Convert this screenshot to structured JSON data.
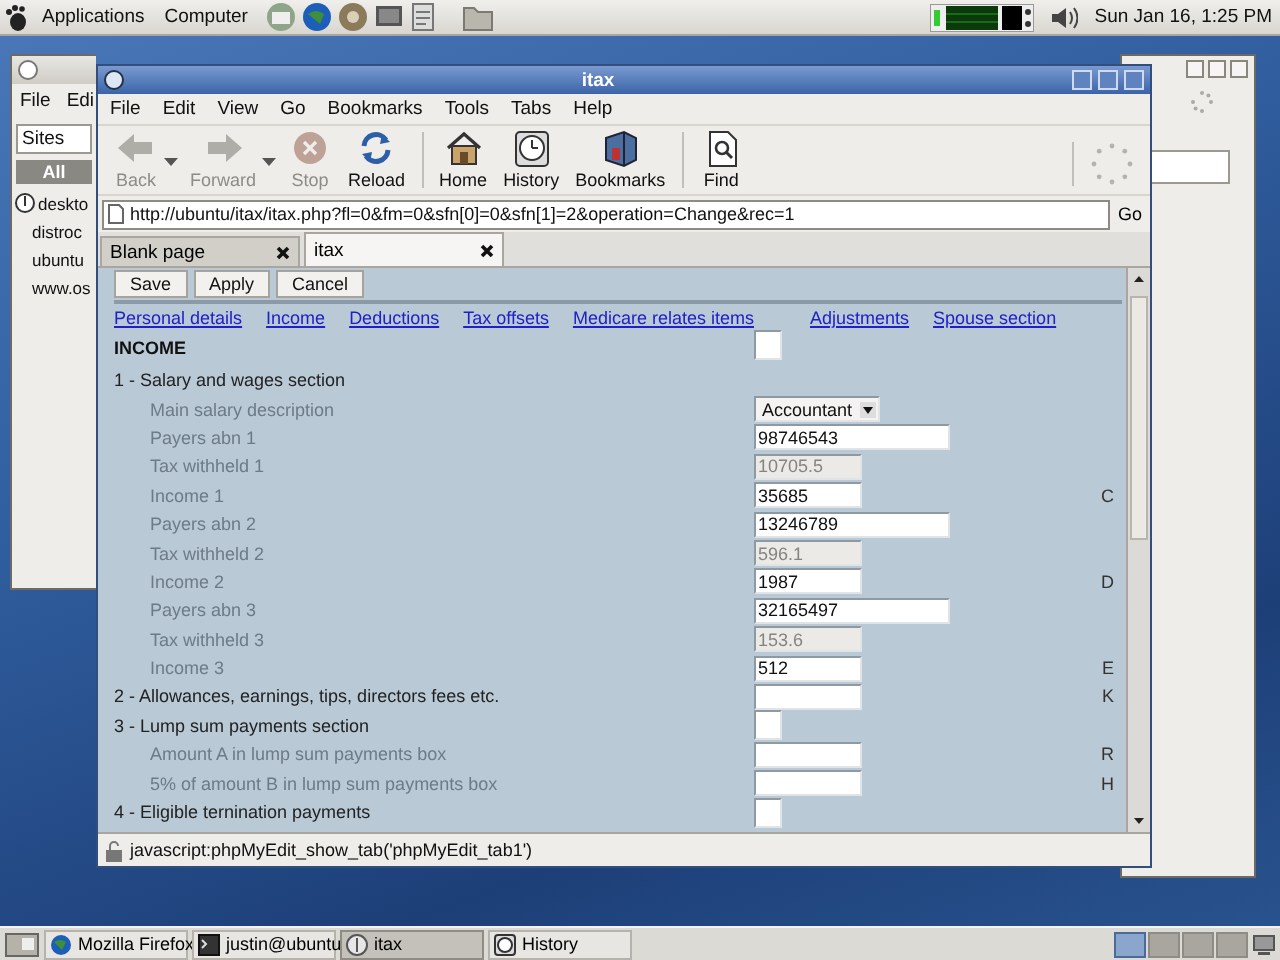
{
  "top_panel": {
    "menus": [
      {
        "label": "Applications"
      },
      {
        "label": "Computer"
      }
    ],
    "clock": "Sun Jan 16,  1:25 PM"
  },
  "back_window": {
    "menu": [
      "File",
      "Edi"
    ],
    "search_label": "Sites",
    "filter": {
      "label": "All",
      "selected": true
    },
    "sites": [
      {
        "label": "deskto",
        "has_icon": true
      },
      {
        "label": "distroc",
        "has_icon": false
      },
      {
        "label": "ubuntu",
        "has_icon": false
      },
      {
        "label": "www.os",
        "has_icon": false
      }
    ]
  },
  "browser": {
    "title": "itax",
    "menu": [
      "File",
      "Edit",
      "View",
      "Go",
      "Bookmarks",
      "Tools",
      "Tabs",
      "Help"
    ],
    "toolbar": [
      {
        "kind": "back",
        "label": "Back",
        "disabled": true,
        "dropdown": true
      },
      {
        "kind": "forward",
        "label": "Forward",
        "disabled": true,
        "dropdown": true
      },
      {
        "kind": "stop",
        "label": "Stop",
        "disabled": true,
        "dropdown": false
      },
      {
        "kind": "reload",
        "label": "Reload",
        "disabled": false,
        "dropdown": false
      },
      {
        "kind": "separator"
      },
      {
        "kind": "home",
        "label": "Home",
        "disabled": false,
        "dropdown": false
      },
      {
        "kind": "history",
        "label": "History",
        "disabled": false,
        "dropdown": false
      },
      {
        "kind": "bookmarks",
        "label": "Bookmarks",
        "disabled": false,
        "dropdown": false
      },
      {
        "kind": "separator"
      },
      {
        "kind": "find",
        "label": "Find",
        "disabled": false,
        "dropdown": false
      }
    ],
    "address": "http://ubuntu/itax/itax.php?fl=0&fm=0&sfn[0]=0&sfn[1]=2&operation=Change&rec=1",
    "go": "Go",
    "tabs": [
      {
        "label": "Blank page",
        "selected": false
      },
      {
        "label": "itax",
        "selected": true
      }
    ],
    "form_buttons": [
      "Save",
      "Apply",
      "Cancel"
    ],
    "section_links": [
      "Personal details",
      "Income",
      "Deductions",
      "Tax offsets",
      "Medicare relates items",
      "Adjustments",
      "Spouse section"
    ],
    "rows": [
      {
        "kind": "title",
        "label": "INCOME",
        "control": {
          "kind": "small"
        }
      },
      {
        "kind": "heading",
        "label": "1 - Salary and wages section"
      },
      {
        "kind": "field",
        "label": "Main salary description",
        "control": {
          "kind": "select",
          "value": "Accountant"
        }
      },
      {
        "kind": "field",
        "label": "Payers abn 1",
        "control": {
          "kind": "wide",
          "value": "98746543"
        }
      },
      {
        "kind": "field",
        "label": "Tax withheld 1",
        "control": {
          "kind": "readonly",
          "value": "10705.5"
        }
      },
      {
        "kind": "field",
        "label": "Income 1",
        "control": {
          "kind": "text",
          "value": "35685"
        },
        "code": "C"
      },
      {
        "kind": "field",
        "label": "Payers abn 2",
        "control": {
          "kind": "wide",
          "value": "13246789"
        }
      },
      {
        "kind": "field",
        "label": "Tax withheld 2",
        "control": {
          "kind": "readonly",
          "value": "596.1"
        }
      },
      {
        "kind": "field",
        "label": "Income 2",
        "control": {
          "kind": "text",
          "value": "1987"
        },
        "code": "D"
      },
      {
        "kind": "field",
        "label": "Payers abn 3",
        "control": {
          "kind": "wide",
          "value": "32165497"
        }
      },
      {
        "kind": "field",
        "label": "Tax withheld 3",
        "control": {
          "kind": "readonly",
          "value": "153.6"
        }
      },
      {
        "kind": "field",
        "label": "Income 3",
        "control": {
          "kind": "text",
          "value": "512"
        },
        "code": "E"
      },
      {
        "kind": "heading",
        "label": "2 - Allowances, earnings, tips, directors fees etc.",
        "control": {
          "kind": "text"
        },
        "code": "K"
      },
      {
        "kind": "heading",
        "label": "3 - Lump sum payments section",
        "control": {
          "kind": "small"
        }
      },
      {
        "kind": "field",
        "label": "Amount A in lump sum payments box",
        "control": {
          "kind": "text"
        },
        "code": "R"
      },
      {
        "kind": "field",
        "label": "5% of amount B in lump sum payments box",
        "control": {
          "kind": "text"
        },
        "code": "H"
      },
      {
        "kind": "heading",
        "label": "4 - Eligible ternination payments",
        "control": {
          "kind": "small"
        }
      }
    ],
    "status": "javascript:phpMyEdit_show_tab('phpMyEdit_tab1')"
  },
  "taskbar": {
    "items": [
      {
        "label": "Mozilla Firefox",
        "selected": false
      },
      {
        "label": "justin@ubuntu",
        "selected": false
      },
      {
        "label": "itax",
        "selected": true
      },
      {
        "label": "History",
        "selected": false
      }
    ],
    "workspaces": [
      {
        "selected": true
      },
      {
        "selected": false
      },
      {
        "selected": false
      },
      {
        "selected": false
      }
    ]
  }
}
